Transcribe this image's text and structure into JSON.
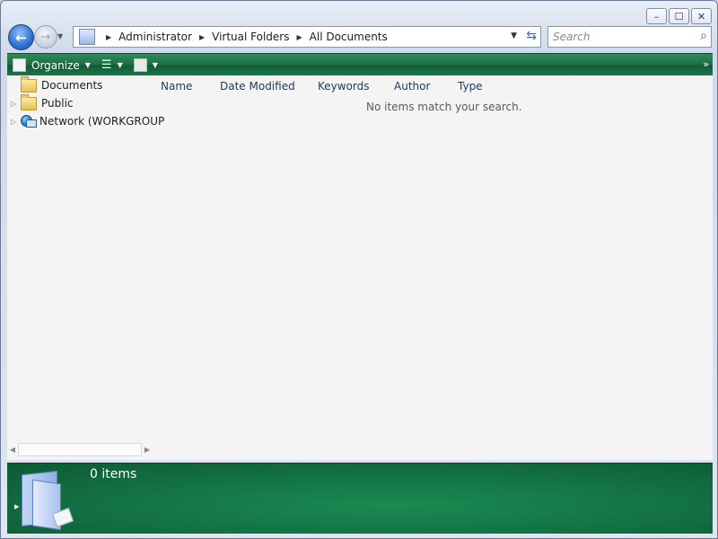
{
  "window": {
    "caption": {
      "minimize": "–",
      "maximize": "☐",
      "close": "✕"
    }
  },
  "nav": {
    "back_glyph": "←",
    "forward_glyph": "→",
    "breadcrumbs": [
      "Administrator",
      "Virtual Folders",
      "All Documents"
    ],
    "search_placeholder": "Search"
  },
  "toolbar": {
    "organize_label": "Organize",
    "more_glyph": "»"
  },
  "tree": {
    "items": [
      {
        "label": "Documents",
        "icon": "folder-icon",
        "expandable": false
      },
      {
        "label": "Public",
        "icon": "folder-icon",
        "expandable": true
      },
      {
        "label": "Network (WORKGROUP",
        "icon": "network-icon",
        "expandable": true
      }
    ]
  },
  "list": {
    "columns": [
      "Name",
      "Date Modified",
      "Keywords",
      "Author",
      "Type"
    ],
    "empty_message": "No items match your search."
  },
  "details": {
    "count_text": "0 items"
  },
  "colors": {
    "toolbar_green": "#1c6d43",
    "details_green": "#157a48",
    "content_bg": "#f4f4f4"
  }
}
